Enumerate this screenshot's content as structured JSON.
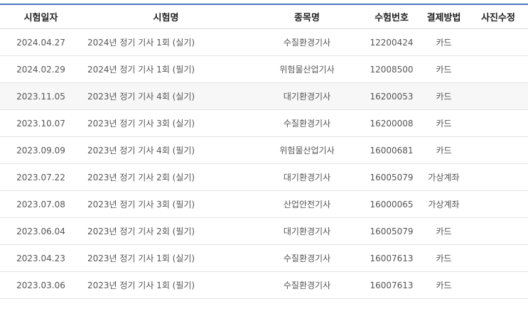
{
  "table": {
    "headers": {
      "date": "시험일자",
      "exam": "시험명",
      "subject": "종목명",
      "number": "수험번호",
      "payment": "결제방법",
      "photo": "사진수정"
    },
    "rows": [
      {
        "date": "2024.04.27",
        "exam": "2024년 정기 기사 1회 (실기)",
        "subject": "수질환경기사",
        "number": "12200424",
        "payment": "카드",
        "photo": ""
      },
      {
        "date": "2024.02.29",
        "exam": "2024년 정기 기사 1회 (필기)",
        "subject": "위험물산업기사",
        "number": "12008500",
        "payment": "카드",
        "photo": ""
      },
      {
        "date": "2023.11.05",
        "exam": "2023년 정기 기사 4회 (실기)",
        "subject": "대기환경기사",
        "number": "16200053",
        "payment": "카드",
        "photo": ""
      },
      {
        "date": "2023.10.07",
        "exam": "2023년 정기 기사 3회 (실기)",
        "subject": "수질환경기사",
        "number": "16200008",
        "payment": "카드",
        "photo": ""
      },
      {
        "date": "2023.09.09",
        "exam": "2023년 정기 기사 4회 (필기)",
        "subject": "위험물산업기사",
        "number": "16000681",
        "payment": "카드",
        "photo": ""
      },
      {
        "date": "2023.07.22",
        "exam": "2023년 정기 기사 2회 (실기)",
        "subject": "대기환경기사",
        "number": "16005079",
        "payment": "가상계좌",
        "photo": ""
      },
      {
        "date": "2023.07.08",
        "exam": "2023년 정기 기사 3회 (필기)",
        "subject": "산업안전기사",
        "number": "16000065",
        "payment": "가상계좌",
        "photo": ""
      },
      {
        "date": "2023.06.04",
        "exam": "2023년 정기 기사 2회 (필기)",
        "subject": "대기환경기사",
        "number": "16005079",
        "payment": "카드",
        "photo": ""
      },
      {
        "date": "2023.04.23",
        "exam": "2023년 정기 기사 1회 (실기)",
        "subject": "수질환경기사",
        "number": "16007613",
        "payment": "카드",
        "photo": ""
      },
      {
        "date": "2023.03.06",
        "exam": "2023년 정기 기사 1회 (필기)",
        "subject": "수질환경기사",
        "number": "16007613",
        "payment": "카드",
        "photo": ""
      }
    ]
  }
}
